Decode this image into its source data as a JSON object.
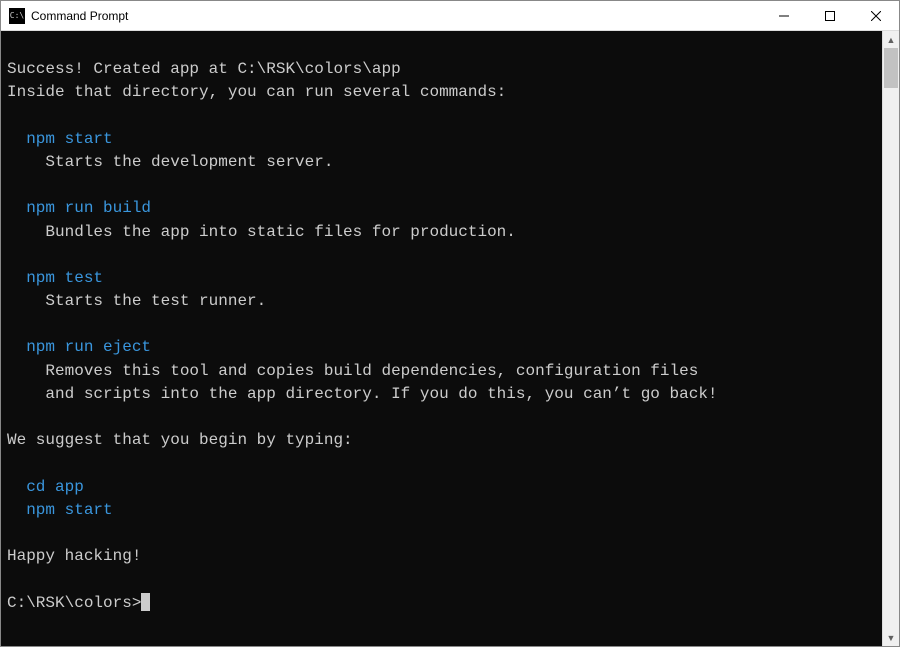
{
  "window": {
    "title": "Command Prompt",
    "icon_label": "C:\\"
  },
  "terminal": {
    "success_line_prefix": "Success! Created app at ",
    "success_path": "C:\\RSK\\colors\\app",
    "inside_line": "Inside that directory, you can run several commands:",
    "commands": [
      {
        "cmd": "npm start",
        "desc": "Starts the development server."
      },
      {
        "cmd": "npm run build",
        "desc": "Bundles the app into static files for production."
      },
      {
        "cmd": "npm test",
        "desc": "Starts the test runner."
      },
      {
        "cmd": "npm run eject",
        "desc": "Removes this tool and copies build dependencies, configuration files",
        "desc2": "and scripts into the app directory. If you do this, you can’t go back!"
      }
    ],
    "suggest_line": "We suggest that you begin by typing:",
    "suggest_cmd1": "cd app",
    "suggest_cmd2": "npm start",
    "happy": "Happy hacking!",
    "prompt": "C:\\RSK\\colors>"
  },
  "colors": {
    "cyan": "#3a96dd",
    "fg": "#cccccc",
    "bg": "#0c0c0c"
  }
}
